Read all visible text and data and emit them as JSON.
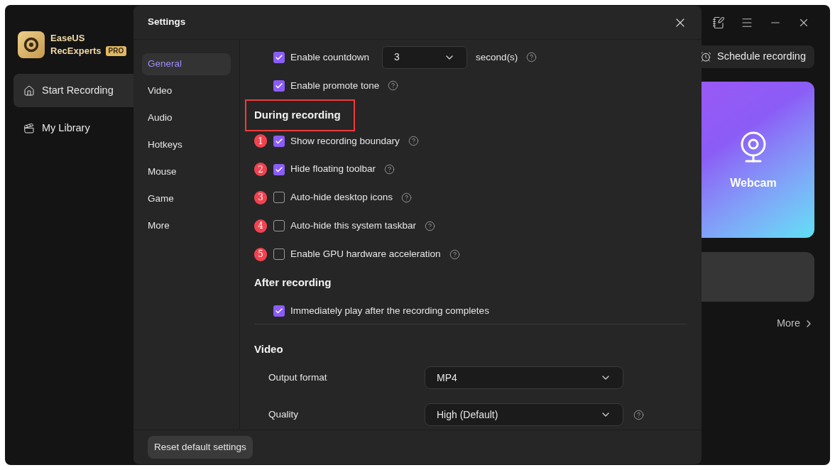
{
  "app": {
    "logo": {
      "name_lines": [
        "EaseUS",
        "RecExperts"
      ],
      "badge": "PRO"
    },
    "sidebar": {
      "items": [
        {
          "label": "Start Recording",
          "kind": "home",
          "selected": true
        },
        {
          "label": "My Library",
          "kind": "library",
          "selected": false
        }
      ]
    },
    "schedule_button": "Schedule recording",
    "webcam_card": {
      "label": "Webcam"
    },
    "more_link": "More"
  },
  "settings": {
    "title": "Settings",
    "nav": [
      {
        "label": "General",
        "selected": true
      },
      {
        "label": "Video",
        "selected": false
      },
      {
        "label": "Audio",
        "selected": false
      },
      {
        "label": "Hotkeys",
        "selected": false
      },
      {
        "label": "Mouse",
        "selected": false
      },
      {
        "label": "Game",
        "selected": false
      },
      {
        "label": "More",
        "selected": false
      }
    ],
    "top_options": [
      {
        "label": "Enable countdown",
        "checked": true,
        "select": "3",
        "suffix": "second(s)",
        "help": true
      },
      {
        "label": "Enable promote tone",
        "checked": true,
        "help": true
      }
    ],
    "during_recording": {
      "heading": "During recording",
      "highlighted": true,
      "options": [
        {
          "marker": "1",
          "label": "Show recording boundary",
          "checked": true,
          "help": true
        },
        {
          "marker": "2",
          "label": "Hide floating toolbar",
          "checked": true,
          "help": true
        },
        {
          "marker": "3",
          "label": "Auto-hide desktop icons",
          "checked": false,
          "help": true
        },
        {
          "marker": "4",
          "label": "Auto-hide this system taskbar",
          "checked": false,
          "help": true
        },
        {
          "marker": "5",
          "label": "Enable GPU hardware acceleration",
          "checked": false,
          "help": true
        }
      ]
    },
    "after_recording": {
      "heading": "After recording",
      "options": [
        {
          "label": "Immediately play after the recording completes",
          "checked": true,
          "help": false
        }
      ]
    },
    "video": {
      "heading": "Video",
      "fields": [
        {
          "label": "Output format",
          "value": "MP4",
          "help": false
        },
        {
          "label": "Quality",
          "value": "High (Default)",
          "help": true
        }
      ]
    },
    "reset_button": "Reset default settings"
  }
}
